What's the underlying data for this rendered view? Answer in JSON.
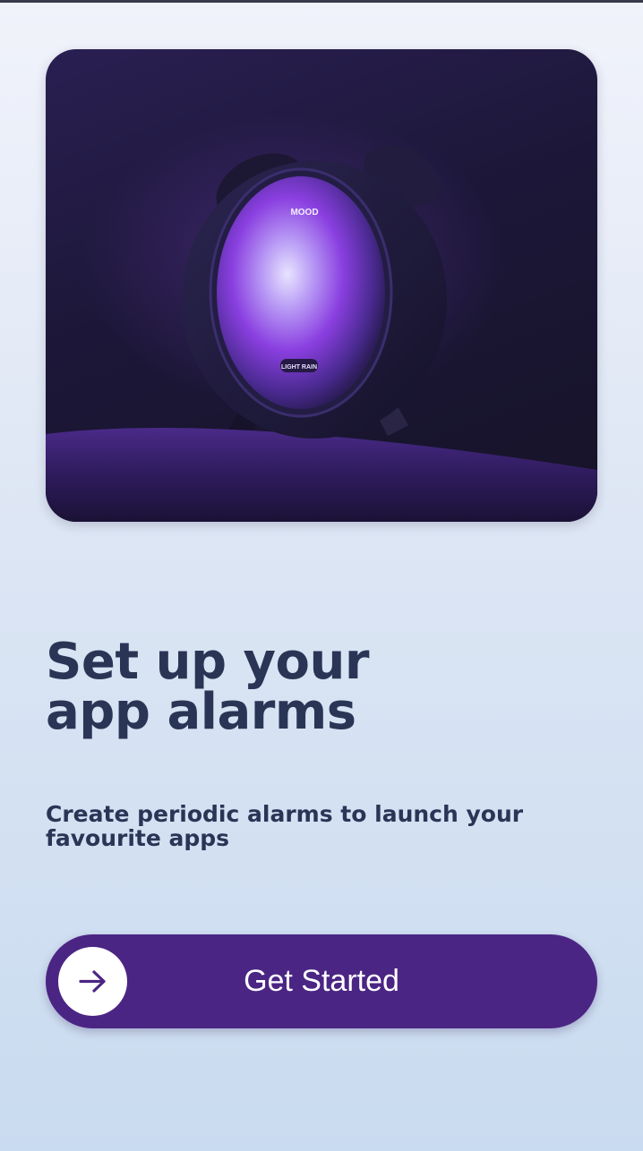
{
  "hero": {
    "clock_top_label": "MOOD",
    "clock_bottom_label": "LIGHT RAIN"
  },
  "onboarding": {
    "title_line1": "Set up your",
    "title_line2": "app alarms",
    "subtitle": "Create periodic alarms to launch your favourite apps"
  },
  "cta": {
    "label": "Get Started",
    "icon": "arrow-right-icon"
  },
  "colors": {
    "accent": "#4b2584",
    "text": "#2a3556"
  }
}
